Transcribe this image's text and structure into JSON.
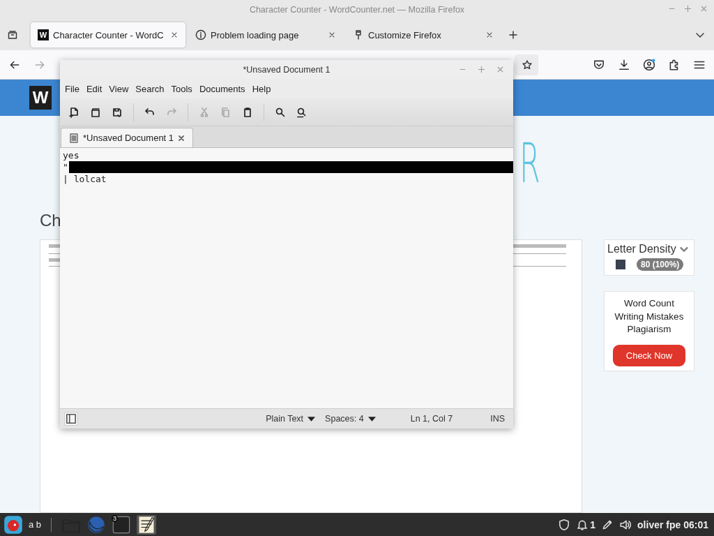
{
  "browser": {
    "title": "Character Counter - WordCounter.net — Mozilla Firefox",
    "tabs": [
      {
        "label": "Character Counter - WordC",
        "selected": true,
        "kind": "favicon",
        "favicon": "W"
      },
      {
        "label": "Problem loading page",
        "selected": false,
        "kind": "info"
      },
      {
        "label": "Customize Firefox",
        "selected": false,
        "kind": "brush"
      }
    ],
    "nav_buttons": [
      {
        "kind": "back",
        "disabled": false
      },
      {
        "kind": "forward",
        "disabled": true
      }
    ],
    "page": {
      "logo": "W",
      "big_title": "R",
      "heading": "Ch",
      "density": {
        "title": "Letter Density",
        "items": [
          {
            "color": "#3a4150",
            "count": "80 (100%)"
          }
        ]
      },
      "ad": {
        "lines": [
          "Word Count",
          "Writing Mistakes",
          "Plagiarism"
        ],
        "button": "Check Now"
      }
    }
  },
  "editor": {
    "title": "*Unsaved Document 1",
    "menu": [
      "File",
      "Edit",
      "View",
      "Search",
      "Tools",
      "Documents",
      "Help"
    ],
    "toolbar": [
      {
        "buttons": [
          {
            "kind": "new",
            "disabled": false
          },
          {
            "kind": "open",
            "disabled": false
          },
          {
            "kind": "save",
            "disabled": false
          }
        ]
      },
      {
        "buttons": [
          {
            "kind": "undo",
            "disabled": false
          },
          {
            "kind": "redo",
            "disabled": true
          }
        ]
      },
      {
        "buttons": [
          {
            "kind": "cut",
            "disabled": true
          },
          {
            "kind": "copy",
            "disabled": true
          },
          {
            "kind": "paste",
            "disabled": false
          }
        ]
      },
      {
        "buttons": [
          {
            "kind": "find",
            "disabled": false
          },
          {
            "kind": "replace",
            "disabled": false
          }
        ]
      }
    ],
    "doc_tab": "*Unsaved Document 1",
    "lines": [
      {
        "text": "yes",
        "highlighted": false
      },
      {
        "text": "\"",
        "highlighted": true
      },
      {
        "text": "| lolcat",
        "highlighted": false
      }
    ],
    "status": {
      "language": "Plain Text",
      "indent": "Spaces: 4",
      "position": "Ln 1, Col 7",
      "mode": "INS"
    }
  },
  "taskbar": {
    "label": "a b",
    "terminal_badge": "3",
    "notifications": "1",
    "user_clock": "oliver fpe 06:01"
  }
}
